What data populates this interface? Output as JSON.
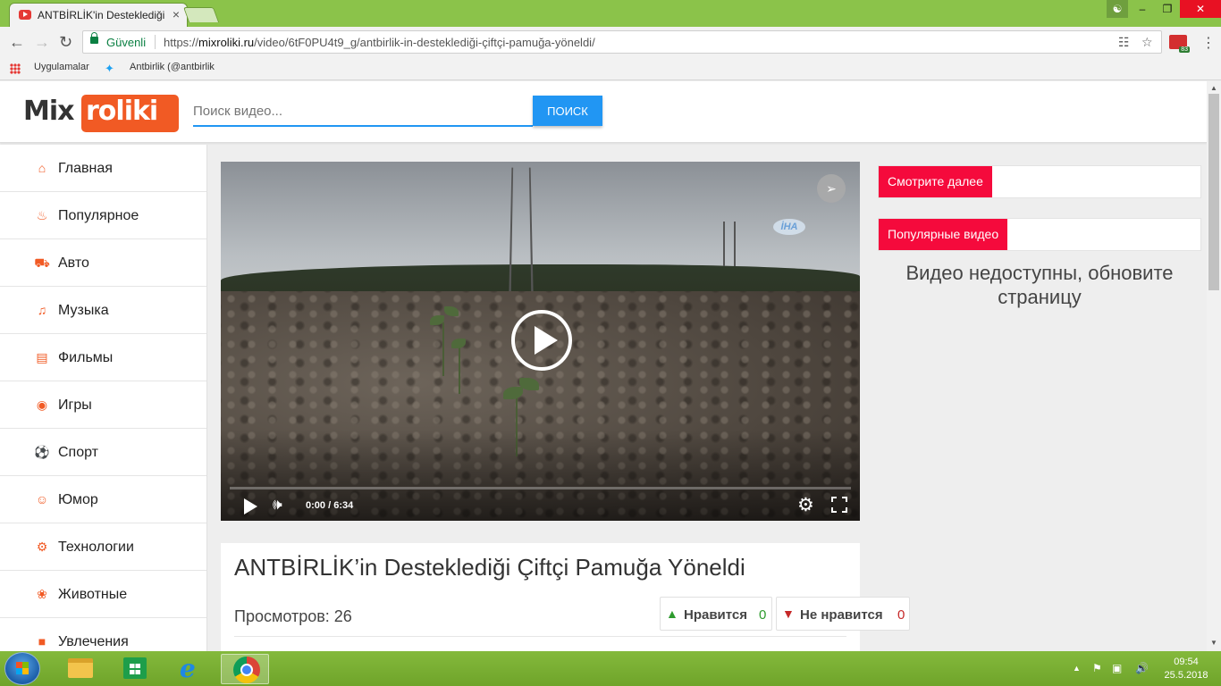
{
  "browser": {
    "tab_title": "ANTBİRLİK'in Desteklediği",
    "tab_close": "×",
    "secure_label": "Güvenli",
    "url_prefix": "https://",
    "url_host": "mixroliki.ru",
    "url_path": "/video/6tF0PU4t9_g/antbirlik-in-desteklediği-çiftçi-pamuğa-yöneldi/",
    "window_controls": {
      "user": "person-icon",
      "min": "–",
      "max": "❐",
      "close": "✕"
    },
    "ext_badge": "83",
    "bookmarks": [
      {
        "label": "Uygulamalar",
        "icon": "apps-grid-icon"
      },
      {
        "label": "Antbirlik (@antbirlik",
        "icon": "twitter-icon"
      }
    ]
  },
  "site": {
    "logo_mix": "Mix",
    "logo_roliki": "roliki",
    "search_placeholder": "Поиск видео...",
    "search_button": "ПОИСК",
    "accent_color": "#f15a24",
    "primary_color": "#2196f3"
  },
  "sidebar": {
    "items": [
      {
        "label": "Главная",
        "icon": "home-icon"
      },
      {
        "label": "Популярное",
        "icon": "fire-icon"
      },
      {
        "label": "Авто",
        "icon": "car-icon"
      },
      {
        "label": "Музыка",
        "icon": "music-note-icon"
      },
      {
        "label": "Фильмы",
        "icon": "film-icon"
      },
      {
        "label": "Игры",
        "icon": "gamepad-icon"
      },
      {
        "label": "Спорт",
        "icon": "soccer-ball-icon"
      },
      {
        "label": "Юмор",
        "icon": "smile-icon"
      },
      {
        "label": "Технологии",
        "icon": "gears-icon"
      },
      {
        "label": "Животные",
        "icon": "paw-icon"
      },
      {
        "label": "Увлечения",
        "icon": "hobby-icon"
      }
    ]
  },
  "player": {
    "current_time": "0:00",
    "duration": "6:34",
    "progress": 0,
    "watermark": "İHA"
  },
  "video": {
    "title": "ANTBİRLİK’in Desteklediği Çiftçi Pamuğa Yöneldi",
    "views_label": "Просмотров:",
    "views": "26",
    "like_label": "Нравится",
    "like_count": "0",
    "dislike_label": "Не нравится",
    "dislike_count": "0"
  },
  "right_panel": {
    "watch_next": "Смотрите далее",
    "popular": "Популярные видео",
    "unavailable": "Видео недоступны, обновите страницу",
    "tag_color": "#f50a3c"
  },
  "taskbar": {
    "time": "09:54",
    "date": "25.5.2018"
  }
}
